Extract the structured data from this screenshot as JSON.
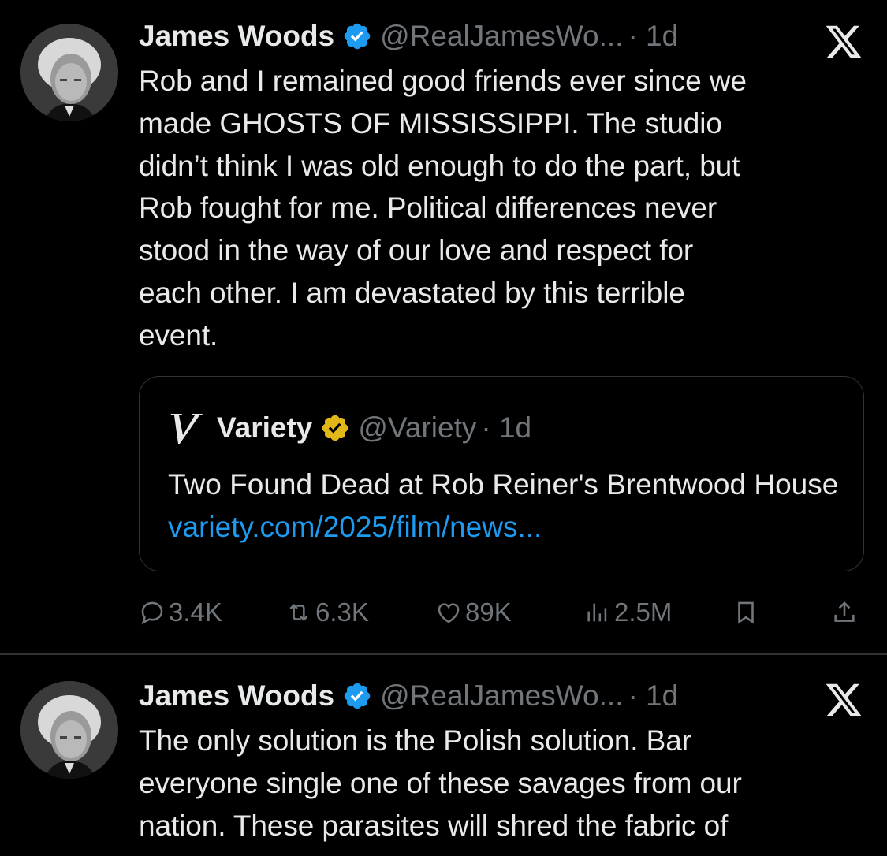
{
  "tweets": [
    {
      "author_name": "James Woods",
      "handle": "@RealJamesWo...",
      "time": "· 1d",
      "text": "Rob and I remained good friends ever since we\nmade GHOSTS OF MISSISSIPPI. The studio\ndidn’t think I was old enough to do the part, but\nRob fought for me. Political differences never\nstood in the way of our love and respect for\neach other. I am devastated by this terrible\nevent.",
      "quote": {
        "author_name": "Variety",
        "handle": "@Variety",
        "time": "· 1d",
        "text": "Two Found Dead at Rob Reiner's Brentwood House ",
        "link": "variety.com/2025/film/news..."
      },
      "stats": {
        "replies": "3.4K",
        "reposts": "6.3K",
        "likes": "89K",
        "views": "2.5M"
      }
    },
    {
      "author_name": "James Woods",
      "handle": "@RealJamesWo...",
      "time": "· 1d",
      "text": "The only solution is the Polish solution. Bar\neveryone single one of these savages from our\nnation. These parasites will shred the fabric of"
    }
  ],
  "icons": {
    "verified_color": "#1d9bf0",
    "gold_verified_color": "#e2b719",
    "link_color": "#1d9bf0"
  }
}
